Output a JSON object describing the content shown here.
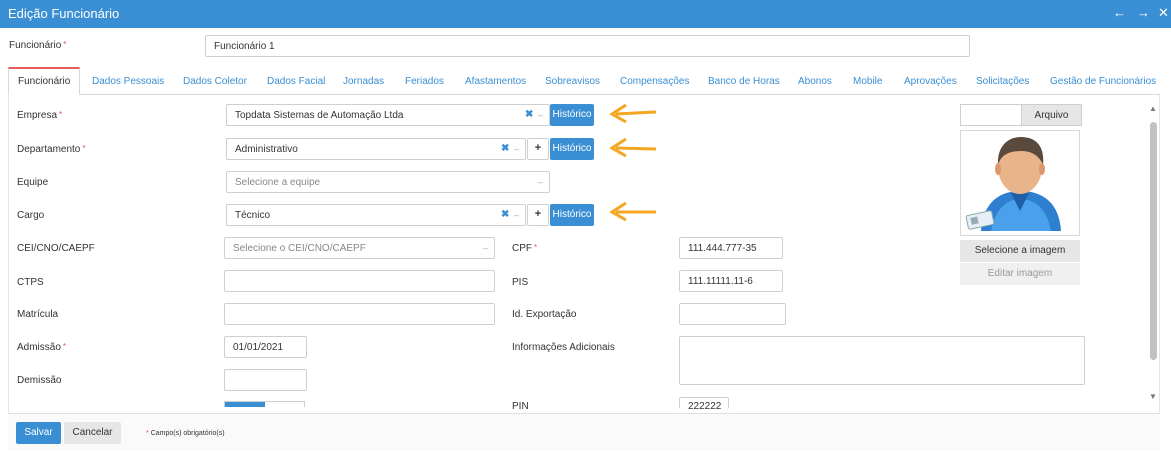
{
  "window": {
    "title": "Edição Funcionário",
    "back_icon": "arrow-left-icon",
    "forward_icon": "arrow-right-icon",
    "close_icon": "close-icon"
  },
  "employee": {
    "label": "Funcionário",
    "value": "Funcionário 1"
  },
  "tabs": [
    "Funcionário",
    "Dados Pessoais",
    "Dados Coletor",
    "Dados Facial",
    "Jornadas",
    "Feriados",
    "Afastamentos",
    "Sobreavisos",
    "Compensações",
    "Banco de Horas",
    "Abonos",
    "Mobile",
    "Aprovações",
    "Solicitações",
    "Gestão de Funcionários"
  ],
  "form": {
    "empresa": {
      "label": "Empresa",
      "value": "Topdata Sistemas de Automação Ltda",
      "history": "Histórico"
    },
    "departamento": {
      "label": "Departamento",
      "value": "Administrativo",
      "history": "Histórico",
      "add": "+"
    },
    "equipe": {
      "label": "Equipe",
      "placeholder": "Selecione a equipe"
    },
    "cargo": {
      "label": "Cargo",
      "value": "Técnico",
      "history": "Histórico",
      "add": "+"
    },
    "cei": {
      "label": "CEI/CNO/CAEPF",
      "placeholder": "Selecione o CEI/CNO/CAEPF"
    },
    "ctps": {
      "label": "CTPS",
      "value": ""
    },
    "matricula": {
      "label": "Matrícula",
      "value": ""
    },
    "admissao": {
      "label": "Admissão",
      "value": "01/01/2021"
    },
    "demissao": {
      "label": "Demissão",
      "value": ""
    },
    "cpf": {
      "label": "CPF",
      "value": "111.444.777-35"
    },
    "pis": {
      "label": "PIS",
      "value": "111.11111.11-6"
    },
    "id_exportacao": {
      "label": "Id. Exportação",
      "value": ""
    },
    "info_adicionais": {
      "label": "Informações Adicionais",
      "value": ""
    },
    "pin": {
      "label": "PIN",
      "value": "222222"
    }
  },
  "photo": {
    "file_button": "Arquivo",
    "select_image": "Selecione a imagem",
    "edit_image": "Editar imagem",
    "avatar_icon": "user-avatar-icon"
  },
  "footer": {
    "save": "Salvar",
    "cancel": "Cancelar",
    "required_note": "Campo(s) obrigatório(s)",
    "required_mark": "*"
  },
  "colors": {
    "accent": "#3a8fd4",
    "required": "#d9534f",
    "annotation_arrow": "#f5a623"
  }
}
